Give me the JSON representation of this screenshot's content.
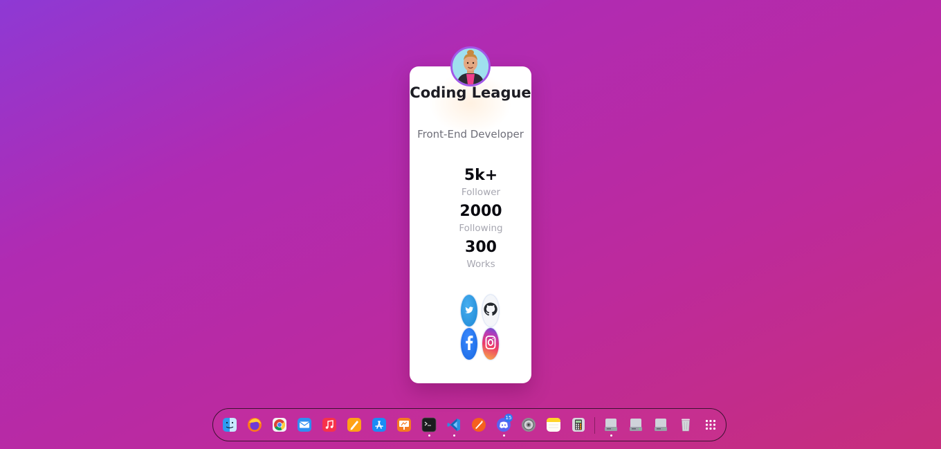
{
  "profile": {
    "name": "Coding League",
    "role": "Front-End Developer",
    "stats": [
      {
        "value": "5k+",
        "label": "Follower"
      },
      {
        "value": "2000",
        "label": "Following"
      },
      {
        "value": "300",
        "label": "Works"
      }
    ],
    "socials": [
      {
        "name": "twitter",
        "icon": "twitter-icon",
        "color": "#1d9bf0"
      },
      {
        "name": "github",
        "icon": "github-icon",
        "color": "#24292f"
      },
      {
        "name": "facebook",
        "icon": "facebook-icon",
        "color": "#1877f2"
      },
      {
        "name": "instagram",
        "icon": "instagram-icon",
        "color": "#e1306c"
      }
    ]
  },
  "dock": {
    "items": [
      {
        "name": "finder",
        "icon": "finder-icon"
      },
      {
        "name": "firefox",
        "icon": "firefox-icon"
      },
      {
        "name": "chrome",
        "icon": "chrome-icon"
      },
      {
        "name": "mail",
        "icon": "mail-icon"
      },
      {
        "name": "music",
        "icon": "music-icon"
      },
      {
        "name": "pages",
        "icon": "pages-icon"
      },
      {
        "name": "app-store",
        "icon": "app-store-icon"
      },
      {
        "name": "keynote",
        "icon": "keynote-icon"
      },
      {
        "name": "terminal",
        "icon": "terminal-icon",
        "running": true
      },
      {
        "name": "vscode",
        "icon": "vscode-icon",
        "running": true
      },
      {
        "name": "swift-playgrounds",
        "icon": "swift-icon"
      },
      {
        "name": "discord",
        "icon": "discord-icon",
        "running": true,
        "badge": "15"
      },
      {
        "name": "system-preferences",
        "icon": "settings-icon"
      },
      {
        "name": "notes",
        "icon": "notes-icon"
      },
      {
        "name": "calculator",
        "icon": "calculator-icon"
      },
      {
        "name": "drive-1",
        "icon": "drive-icon",
        "running": true
      },
      {
        "name": "drive-2",
        "icon": "drive-icon"
      },
      {
        "name": "drive-3",
        "icon": "drive-icon"
      },
      {
        "name": "trash",
        "icon": "trash-icon"
      },
      {
        "name": "launchpad",
        "icon": "app-grid-icon"
      }
    ]
  }
}
